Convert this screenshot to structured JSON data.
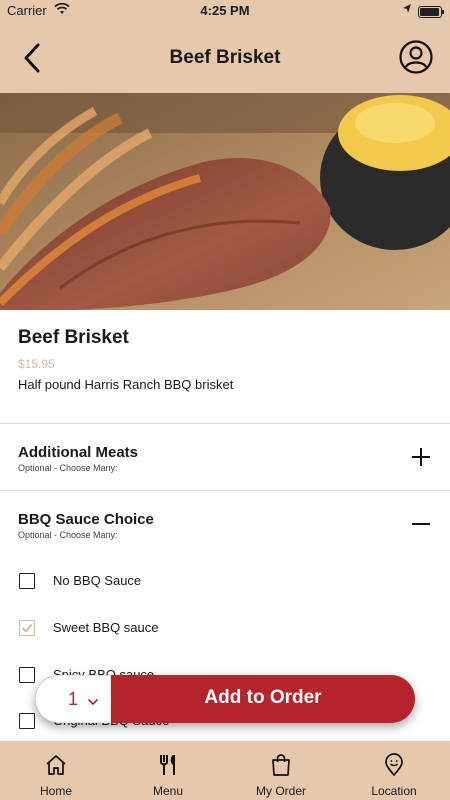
{
  "status_bar": {
    "carrier": "Carrier",
    "time": "4:25 PM"
  },
  "header": {
    "title": "Beef Brisket",
    "icons": [
      "back-arrow-icon",
      "profile-icon"
    ]
  },
  "item": {
    "name": "Beef Brisket",
    "price": "$15.95",
    "description": "Half pound Harris Ranch BBQ brisket"
  },
  "sections": [
    {
      "title": "Additional Meats",
      "subtitle": "Optional - Choose Many:",
      "expanded": false,
      "icon": "plus-icon"
    },
    {
      "title": "BBQ Sauce Choice",
      "subtitle": "Optional - Choose Many:",
      "expanded": true,
      "icon": "minus-icon"
    }
  ],
  "sauce_options": [
    {
      "label": "No BBQ Sauce",
      "checked": false
    },
    {
      "label": "Sweet BBQ sauce",
      "checked": true
    },
    {
      "label": "Spicy BBQ sauce",
      "checked": false
    },
    {
      "label": "Original BBQ Sauce",
      "checked": false
    }
  ],
  "order": {
    "quantity": "1",
    "add_label": "Add to Order"
  },
  "tabs": [
    {
      "label": "Home",
      "icon": "home-icon"
    },
    {
      "label": "Menu",
      "icon": "fork-knife-icon"
    },
    {
      "label": "My Order",
      "icon": "shopping-bag-icon"
    },
    {
      "label": "Location",
      "icon": "location-pin-icon"
    }
  ],
  "colors": {
    "bar": "#e6c8ad",
    "accent": "#b5232d",
    "price": "#d9b79a"
  }
}
